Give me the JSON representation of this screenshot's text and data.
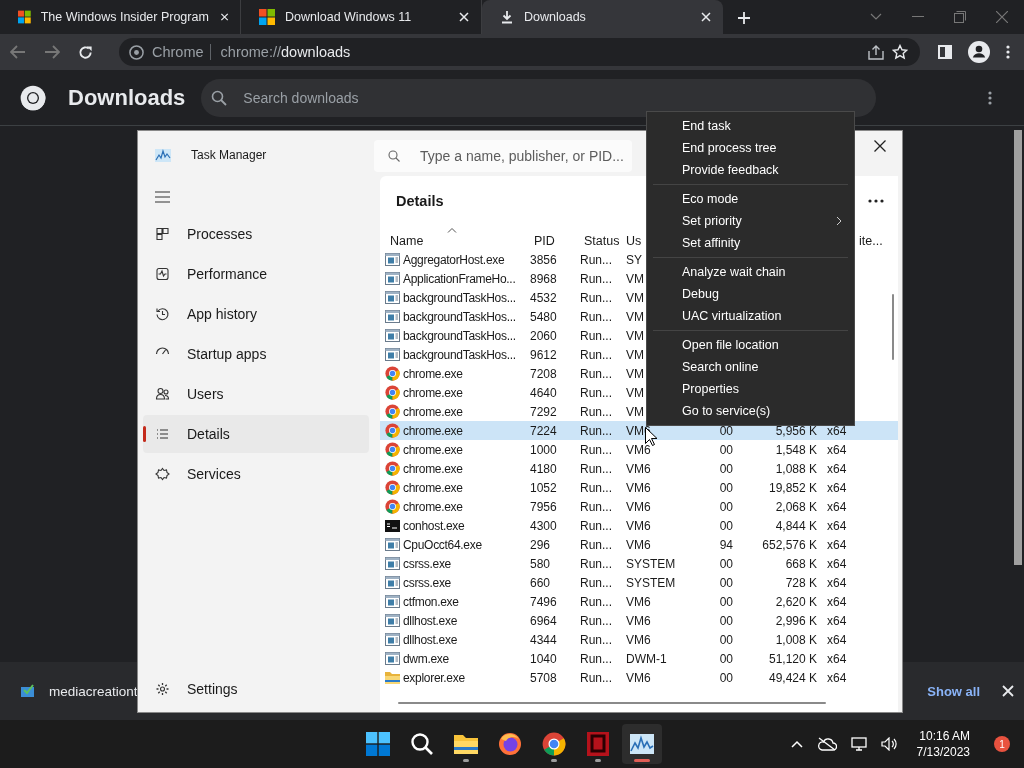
{
  "browser": {
    "tabs": [
      {
        "title": "The Windows Insider Program",
        "selected": false
      },
      {
        "title": "Download Windows 11",
        "selected": false
      },
      {
        "title": "Downloads",
        "selected": true
      }
    ],
    "address": {
      "site": "Chrome",
      "url_scheme": "chrome://",
      "url_path": "downloads"
    },
    "page": {
      "title": "Downloads",
      "search": {
        "placeholder": "Search downloads"
      }
    },
    "download_shelf": {
      "file": "mediacreationt",
      "show_all": "Show all"
    }
  },
  "task_manager": {
    "title": "Task Manager",
    "search": {
      "placeholder": "Type a name, publisher, or PID..."
    },
    "nav": [
      {
        "label": "Processes",
        "selected": false
      },
      {
        "label": "Performance",
        "selected": false
      },
      {
        "label": "App history",
        "selected": false
      },
      {
        "label": "Startup apps",
        "selected": false
      },
      {
        "label": "Users",
        "selected": false
      },
      {
        "label": "Details",
        "selected": true
      },
      {
        "label": "Services",
        "selected": false
      }
    ],
    "settings": "Settings",
    "section_title": "Details",
    "columns": [
      {
        "label": "Name",
        "sorted": true
      },
      {
        "label": "PID",
        "sorted": false
      },
      {
        "label": "Status",
        "sorted": false
      },
      {
        "label": "Us",
        "sorted": false
      },
      {
        "label": "ite...",
        "sorted": false
      }
    ],
    "rows": [
      {
        "kind": "app",
        "name": "AggregatorHost.exe",
        "pid": "3856",
        "status": "Run...",
        "user": "SY",
        "selected": false
      },
      {
        "kind": "app",
        "name": "ApplicationFrameHo...",
        "pid": "8968",
        "status": "Run...",
        "user": "VM",
        "selected": false
      },
      {
        "kind": "app",
        "name": "backgroundTaskHos...",
        "pid": "4532",
        "status": "Run...",
        "user": "VM",
        "selected": false
      },
      {
        "kind": "app",
        "name": "backgroundTaskHos...",
        "pid": "5480",
        "status": "Run...",
        "user": "VM",
        "selected": false
      },
      {
        "kind": "app",
        "name": "backgroundTaskHos...",
        "pid": "2060",
        "status": "Run...",
        "user": "VM",
        "selected": false
      },
      {
        "kind": "app",
        "name": "backgroundTaskHos...",
        "pid": "9612",
        "status": "Run...",
        "user": "VM",
        "selected": false
      },
      {
        "kind": "chrome",
        "name": "chrome.exe",
        "pid": "7208",
        "status": "Run...",
        "user": "VM",
        "selected": false
      },
      {
        "kind": "chrome",
        "name": "chrome.exe",
        "pid": "4640",
        "status": "Run...",
        "user": "VM",
        "selected": false
      },
      {
        "kind": "chrome",
        "name": "chrome.exe",
        "pid": "7292",
        "status": "Run...",
        "user": "VM",
        "selected": false
      },
      {
        "kind": "chrome",
        "name": "chrome.exe",
        "pid": "7224",
        "status": "Run...",
        "user": "VM6",
        "cpu": "00",
        "memory": "5,956 K",
        "arch": "x64",
        "selected": true
      },
      {
        "kind": "chrome",
        "name": "chrome.exe",
        "pid": "1000",
        "status": "Run...",
        "user": "VM6",
        "cpu": "00",
        "memory": "1,548 K",
        "arch": "x64",
        "selected": false
      },
      {
        "kind": "chrome",
        "name": "chrome.exe",
        "pid": "4180",
        "status": "Run...",
        "user": "VM6",
        "cpu": "00",
        "memory": "1,088 K",
        "arch": "x64",
        "selected": false
      },
      {
        "kind": "chrome",
        "name": "chrome.exe",
        "pid": "1052",
        "status": "Run...",
        "user": "VM6",
        "cpu": "00",
        "memory": "19,852 K",
        "arch": "x64",
        "selected": false
      },
      {
        "kind": "chrome",
        "name": "chrome.exe",
        "pid": "7956",
        "status": "Run...",
        "user": "VM6",
        "cpu": "00",
        "memory": "2,068 K",
        "arch": "x64",
        "selected": false
      },
      {
        "kind": "console",
        "name": "conhost.exe",
        "pid": "4300",
        "status": "Run...",
        "user": "VM6",
        "cpu": "00",
        "memory": "4,844 K",
        "arch": "x64",
        "selected": false
      },
      {
        "kind": "app",
        "name": "CpuOcct64.exe",
        "pid": "296",
        "status": "Run...",
        "user": "VM6",
        "cpu": "94",
        "memory": "652,576 K",
        "arch": "x64",
        "selected": false
      },
      {
        "kind": "app",
        "name": "csrss.exe",
        "pid": "580",
        "status": "Run...",
        "user": "SYSTEM",
        "cpu": "00",
        "memory": "668 K",
        "arch": "x64",
        "selected": false
      },
      {
        "kind": "app",
        "name": "csrss.exe",
        "pid": "660",
        "status": "Run...",
        "user": "SYSTEM",
        "cpu": "00",
        "memory": "728 K",
        "arch": "x64",
        "selected": false
      },
      {
        "kind": "app",
        "name": "ctfmon.exe",
        "pid": "7496",
        "status": "Run...",
        "user": "VM6",
        "cpu": "00",
        "memory": "2,620 K",
        "arch": "x64",
        "selected": false
      },
      {
        "kind": "app",
        "name": "dllhost.exe",
        "pid": "6964",
        "status": "Run...",
        "user": "VM6",
        "cpu": "00",
        "memory": "2,996 K",
        "arch": "x64",
        "selected": false
      },
      {
        "kind": "app",
        "name": "dllhost.exe",
        "pid": "4344",
        "status": "Run...",
        "user": "VM6",
        "cpu": "00",
        "memory": "1,008 K",
        "arch": "x64",
        "selected": false
      },
      {
        "kind": "app",
        "name": "dwm.exe",
        "pid": "1040",
        "status": "Run...",
        "user": "DWM-1",
        "cpu": "00",
        "memory": "51,120 K",
        "arch": "x64",
        "selected": false
      },
      {
        "kind": "folder",
        "name": "explorer.exe",
        "pid": "5708",
        "status": "Run...",
        "user": "VM6",
        "cpu": "00",
        "memory": "49,424 K",
        "arch": "x64",
        "selected": false
      }
    ]
  },
  "context_menu": {
    "groups": [
      [
        {
          "label": "End task",
          "submenu": false
        },
        {
          "label": "End process tree",
          "submenu": false
        },
        {
          "label": "Provide feedback",
          "submenu": false
        }
      ],
      [
        {
          "label": "Eco mode",
          "submenu": false
        },
        {
          "label": "Set priority",
          "submenu": true
        },
        {
          "label": "Set affinity",
          "submenu": false
        }
      ],
      [
        {
          "label": "Analyze wait chain",
          "submenu": false
        },
        {
          "label": "Debug",
          "submenu": false
        },
        {
          "label": "UAC virtualization",
          "submenu": false
        }
      ],
      [
        {
          "label": "Open file location",
          "submenu": false
        },
        {
          "label": "Search online",
          "submenu": false
        },
        {
          "label": "Properties",
          "submenu": false
        },
        {
          "label": "Go to service(s)",
          "submenu": false
        }
      ]
    ]
  },
  "taskbar": {
    "apps": [
      {
        "kind": "start",
        "running": false,
        "active": false
      },
      {
        "kind": "search",
        "running": false,
        "active": false
      },
      {
        "kind": "files",
        "running": true,
        "active": false
      },
      {
        "kind": "firefox",
        "running": false,
        "active": false
      },
      {
        "kind": "chrome",
        "running": true,
        "active": false
      },
      {
        "kind": "red-app",
        "running": true,
        "active": false
      },
      {
        "kind": "taskmanager",
        "running": true,
        "active": true
      }
    ],
    "time": "10:16 AM",
    "date": "7/13/2023",
    "notification_count": "1"
  }
}
